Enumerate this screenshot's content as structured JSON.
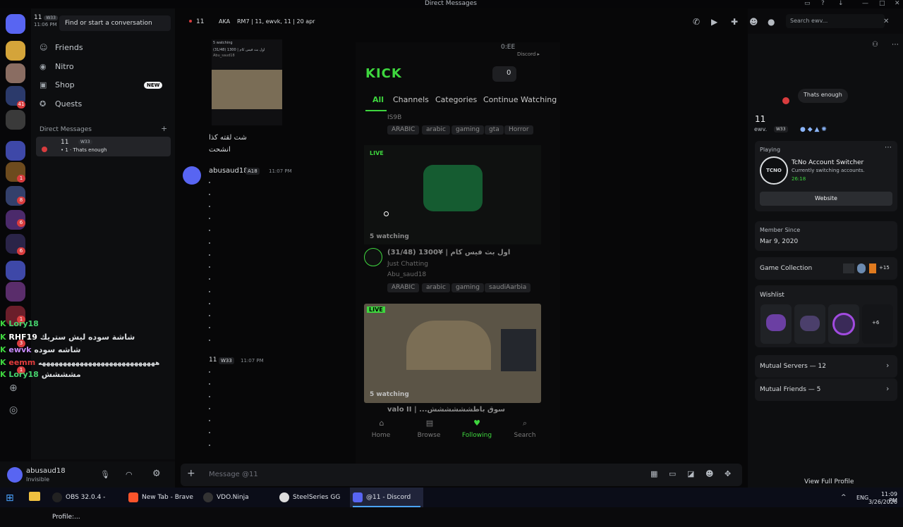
{
  "window": {
    "title": "Direct Messages"
  },
  "sidebar": {
    "user_name": "11",
    "user_tag": "W33",
    "user_time": "11:06 PM",
    "search_placeholder": "Find or start a conversation",
    "nav": [
      {
        "label": "Friends",
        "icon": "friends-icon"
      },
      {
        "label": "Nitro",
        "icon": "nitro-icon"
      },
      {
        "label": "Shop",
        "icon": "shop-icon",
        "badge": "NEW"
      },
      {
        "label": "Quests",
        "icon": "quests-icon"
      }
    ],
    "dm_header": "Direct Messages",
    "dm_add": "+",
    "dm": {
      "name": "11",
      "tag": "W33",
      "status": "• 1 · Thats enough"
    },
    "server_badges": [
      "41",
      "1",
      "8",
      "6",
      "6",
      "1",
      "3",
      "1"
    ]
  },
  "userbar": {
    "name": "abusaud18",
    "status": "Invisible"
  },
  "chat_header": {
    "channel": "11",
    "aka_label": "AKA",
    "aka_names": "RM7 | 11, ewvk, 11 | 20 apr",
    "search_placeholder": "Search ewv..."
  },
  "messages": [
    {
      "arabic_1": "شت لقته كذا",
      "arabic_2": "انشحت"
    },
    {
      "author": "abusaud18",
      "tag": "A18",
      "time": "11:07 PM"
    },
    {
      "author": "11",
      "tag": "W33",
      "time": "11:07 PM"
    }
  ],
  "embed_small": {
    "top": "5 watching",
    "line": "(31/48) 1300 | اول بث فيس كام",
    "user": "Abu_saud18"
  },
  "phone": {
    "status_time": "0:EE",
    "status_app": "Discord ▸",
    "brand": "KICK",
    "count": "0",
    "tabs": [
      "All",
      "Channels",
      "Categories",
      "Continue Watching"
    ],
    "tags_row1": [
      "ARABIC",
      "arabic",
      "gaming",
      "gta",
      "Horror"
    ],
    "prev_user": "IS9B",
    "live": "LIVE",
    "watching": "5 watching",
    "stream_title": "(31/48) 1300¥ | اول بث فيس كام",
    "stream_category": "Just Chatting",
    "stream_user": "Abu_saud18",
    "tags_row2": [
      "ARABIC",
      "arabic",
      "gaming",
      "saudiAarbia"
    ],
    "live2": "LIVE",
    "watching2": "5 watching",
    "stream2_title": "valo II | ...سوق باطشششششش",
    "bottom_nav": [
      "Home",
      "Browse",
      "Following",
      "Search"
    ]
  },
  "composer": {
    "placeholder": "Message @11"
  },
  "overlay_chat": [
    {
      "name": "Lory18",
      "text": "",
      "color": "#46d36d"
    },
    {
      "name": "RHF19",
      "text": "شاشة سوده ليش ستريك",
      "color": "#ffffff"
    },
    {
      "name": "ewvk",
      "text": "شاشه سوده",
      "color": "#c58af9"
    },
    {
      "name": "eemm",
      "text": "ههههههههههههههههههههههههههههه",
      "color": "#e23c3c"
    },
    {
      "name": "Lory18",
      "text": "مشششش",
      "color": "#46d36d"
    }
  ],
  "profile": {
    "bubble": "Thats enough",
    "name": "11",
    "handle": "ewv.",
    "tag": "W33",
    "playing_label": "Playing",
    "game_name": "TcNo Account Switcher",
    "game_desc": "Currently switching accounts.",
    "game_time": "26:18",
    "game_logo": "TCNO",
    "website_btn": "Website",
    "member_since_label": "Member Since",
    "member_since": "Mar 9, 2020",
    "game_collection": "Game Collection",
    "game_count": "+15",
    "wishlist": "Wishlist",
    "wish_more": "+6",
    "mutual_servers": "Mutual Servers — 12",
    "mutual_friends": "Mutual Friends — 5",
    "view_full": "View Full Profile"
  },
  "taskbar": {
    "items": [
      "OBS 32.0.4 - Profile:...",
      "New Tab - Brave",
      "VDO.Ninja",
      "SteelSeries GG",
      "@11 - Discord"
    ],
    "lang": "ENG",
    "time": "11:09 PM",
    "date": "3/26/2026"
  },
  "colors": {
    "accent": "#5865f2",
    "kick": "#3ed63e",
    "danger": "#d83c3e"
  }
}
